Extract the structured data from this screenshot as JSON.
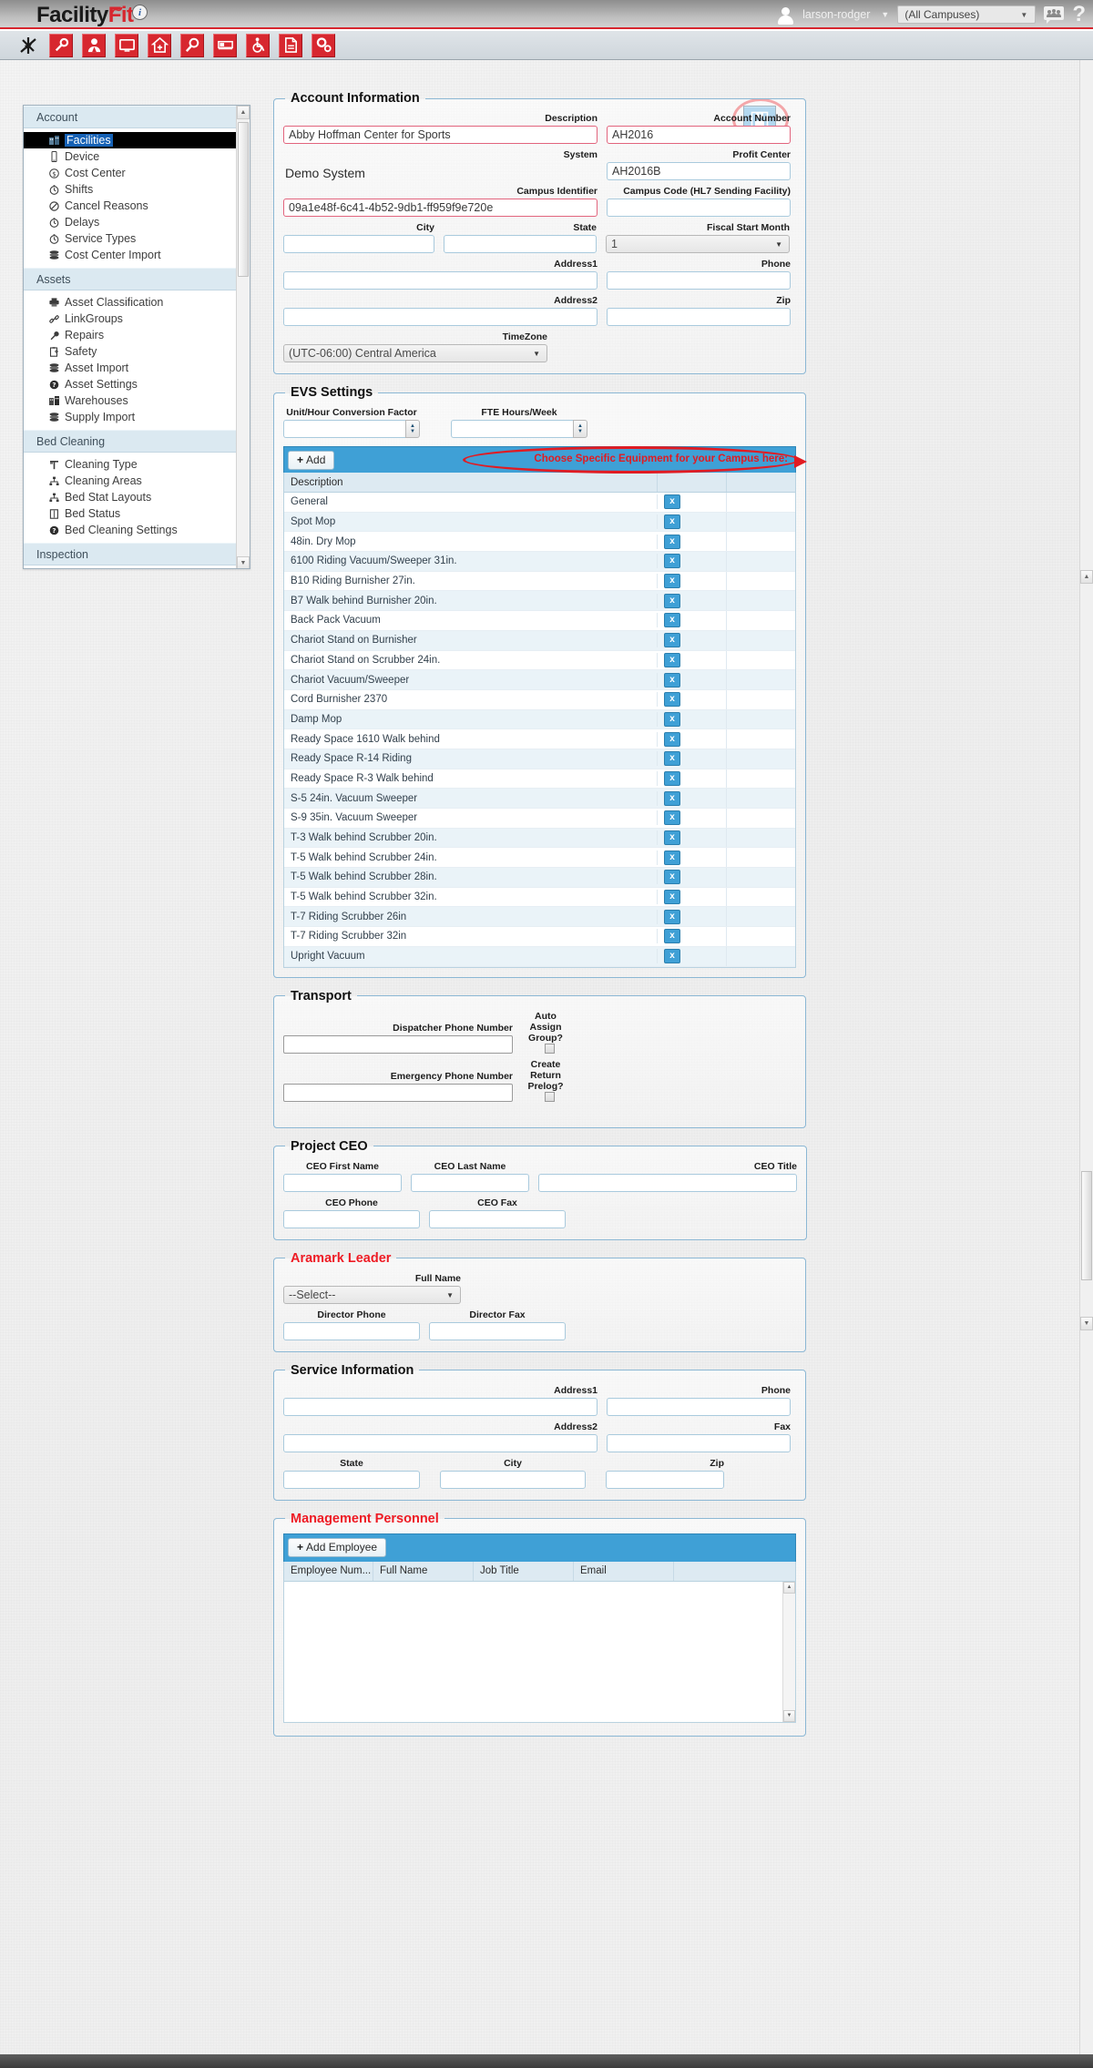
{
  "brand": {
    "name_part1": "Facility",
    "name_part2": "Fit",
    "tm": "®",
    "info": "i"
  },
  "header": {
    "user": "larson-rodger",
    "campus_selected": "(All Campuses)",
    "help": "?",
    "accent_red": "#d7272f"
  },
  "toolbar": {
    "icons": [
      "sparkle-icon",
      "wrench-icon",
      "person-icon",
      "monitor-icon",
      "home-plus-icon",
      "magnifier-icon",
      "bed-icon",
      "wheelchair-icon",
      "document-icon",
      "gears-icon"
    ]
  },
  "sidebar": {
    "groups": [
      {
        "title": "Account",
        "items": [
          {
            "label": "Facilities",
            "icon": "building-icon",
            "selected": true
          },
          {
            "label": "Device",
            "icon": "phone-icon",
            "selected": false
          },
          {
            "label": "Cost Center",
            "icon": "dollar-circle-icon",
            "selected": false
          },
          {
            "label": "Shifts",
            "icon": "clock-icon",
            "selected": false
          },
          {
            "label": "Cancel Reasons",
            "icon": "no-entry-icon",
            "selected": false
          },
          {
            "label": "Delays",
            "icon": "clock-icon",
            "selected": false
          },
          {
            "label": "Service Types",
            "icon": "clock-icon",
            "selected": false
          },
          {
            "label": "Cost Center Import",
            "icon": "stack-icon",
            "selected": false
          }
        ]
      },
      {
        "title": "Assets",
        "items": [
          {
            "label": "Asset Classification",
            "icon": "printer-icon",
            "selected": false
          },
          {
            "label": "LinkGroups",
            "icon": "link-icon",
            "selected": false
          },
          {
            "label": "Repairs",
            "icon": "wrench-icon",
            "selected": false
          },
          {
            "label": "Safety",
            "icon": "clipboard-icon",
            "selected": false
          },
          {
            "label": "Asset Import",
            "icon": "stack-icon",
            "selected": false
          },
          {
            "label": "Asset Settings",
            "icon": "question-circle-icon",
            "selected": false
          },
          {
            "label": "Warehouses",
            "icon": "building-icon",
            "selected": false
          },
          {
            "label": "Supply Import",
            "icon": "stack-icon",
            "selected": false
          }
        ]
      },
      {
        "title": "Bed Cleaning",
        "items": [
          {
            "label": "Cleaning Type",
            "icon": "brush-icon",
            "selected": false
          },
          {
            "label": "Cleaning Areas",
            "icon": "sitemap-icon",
            "selected": false
          },
          {
            "label": "Bed Stat Layouts",
            "icon": "sitemap-icon",
            "selected": false
          },
          {
            "label": "Bed Status",
            "icon": "list-icon",
            "selected": false
          },
          {
            "label": "Bed Cleaning Settings",
            "icon": "question-circle-icon",
            "selected": false
          }
        ]
      },
      {
        "title": "Inspection",
        "items": []
      }
    ]
  },
  "save_button": {
    "name": "save-button",
    "icon": "floppy-disk-icon"
  },
  "annotations": {
    "save_circle": "red-ellipse-around-save",
    "equipment_note": "Choose Specific Equipment for your Campus here:",
    "annotation_color": "#e11b22"
  },
  "account_information": {
    "legend": "Account Information",
    "fields": {
      "description_label": "Description",
      "description_value": "Abby Hoffman Center for Sports",
      "account_number_label": "Account Number",
      "account_number_value": "AH2016",
      "system_label": "System",
      "system_value": "Demo System",
      "profit_center_label": "Profit Center",
      "profit_center_value": "AH2016B",
      "campus_identifier_label": "Campus Identifier",
      "campus_identifier_value": "09a1e48f-6c41-4b52-9db1-ff959f9e720e",
      "campus_code_label": "Campus Code (HL7 Sending Facility)",
      "campus_code_value": "",
      "city_label": "City",
      "city_value": "",
      "state_label": "State",
      "state_value": "",
      "fiscal_start_month_label": "Fiscal Start Month",
      "fiscal_start_month_value": "1",
      "address1_label": "Address1",
      "address1_value": "",
      "phone_label": "Phone",
      "phone_value": "",
      "address2_label": "Address2",
      "address2_value": "",
      "zip_label": "Zip",
      "zip_value": "",
      "timezone_label": "TimeZone",
      "timezone_value": "(UTC-06:00) Central America"
    }
  },
  "evs_settings": {
    "legend": "EVS Settings",
    "unit_hour_label": "Unit/Hour Conversion Factor",
    "unit_hour_value": "",
    "fte_hours_label": "FTE Hours/Week",
    "fte_hours_value": "",
    "add_label": "Add",
    "column_header": "Description",
    "rows": [
      "General",
      "Spot Mop",
      "48in. Dry Mop",
      "6100 Riding Vacuum/Sweeper 31in.",
      "B10 Riding Burnisher 27in.",
      "B7 Walk behind Burnisher 20in.",
      "Back Pack Vacuum",
      "Chariot Stand on Burnisher",
      "Chariot Stand on Scrubber 24in.",
      "Chariot Vacuum/Sweeper",
      "Cord Burnisher 2370",
      "Damp Mop",
      "Ready Space 1610 Walk behind",
      "Ready Space R-14 Riding",
      "Ready Space R-3 Walk behind",
      "S-5 24in. Vacuum Sweeper",
      "S-9 35in. Vacuum Sweeper",
      "T-3 Walk behind Scrubber 20in.",
      "T-5 Walk behind Scrubber 24in.",
      "T-5 Walk behind Scrubber 28in.",
      "T-5 Walk behind Scrubber 32in.",
      "T-7 Riding Scrubber 26in",
      "T-7 Riding Scrubber 32in",
      "Upright Vacuum"
    ],
    "delete_label": "x"
  },
  "transport": {
    "legend": "Transport",
    "dispatcher_label": "Dispatcher Phone Number",
    "dispatcher_value": "",
    "emergency_label": "Emergency Phone Number",
    "emergency_value": "",
    "auto_assign_label": "Auto Assign Group?",
    "auto_assign_checked": false,
    "create_return_label": "Create Return Prelog?",
    "create_return_checked": false
  },
  "project_ceo": {
    "legend": "Project CEO",
    "first_name_label": "CEO First Name",
    "first_name_value": "",
    "last_name_label": "CEO Last Name",
    "last_name_value": "",
    "title_label": "CEO Title",
    "title_value": "",
    "phone_label": "CEO Phone",
    "phone_value": "",
    "fax_label": "CEO Fax",
    "fax_value": ""
  },
  "aramark_leader": {
    "legend": "Aramark Leader",
    "full_name_label": "Full Name",
    "full_name_value": "--Select--",
    "director_phone_label": "Director Phone",
    "director_phone_value": "",
    "director_fax_label": "Director Fax",
    "director_fax_value": ""
  },
  "service_information": {
    "legend": "Service Information",
    "address1_label": "Address1",
    "address1_value": "",
    "phone_label": "Phone",
    "phone_value": "",
    "address2_label": "Address2",
    "address2_value": "",
    "fax_label": "Fax",
    "fax_value": "",
    "state_label": "State",
    "state_value": "",
    "city_label": "City",
    "city_value": "",
    "zip_label": "Zip",
    "zip_value": ""
  },
  "management_personnel": {
    "legend": "Management Personnel",
    "add_employee_label": "Add Employee",
    "columns": [
      "Employee Num...",
      "Full Name",
      "Job Title",
      "Email"
    ],
    "rows": []
  }
}
